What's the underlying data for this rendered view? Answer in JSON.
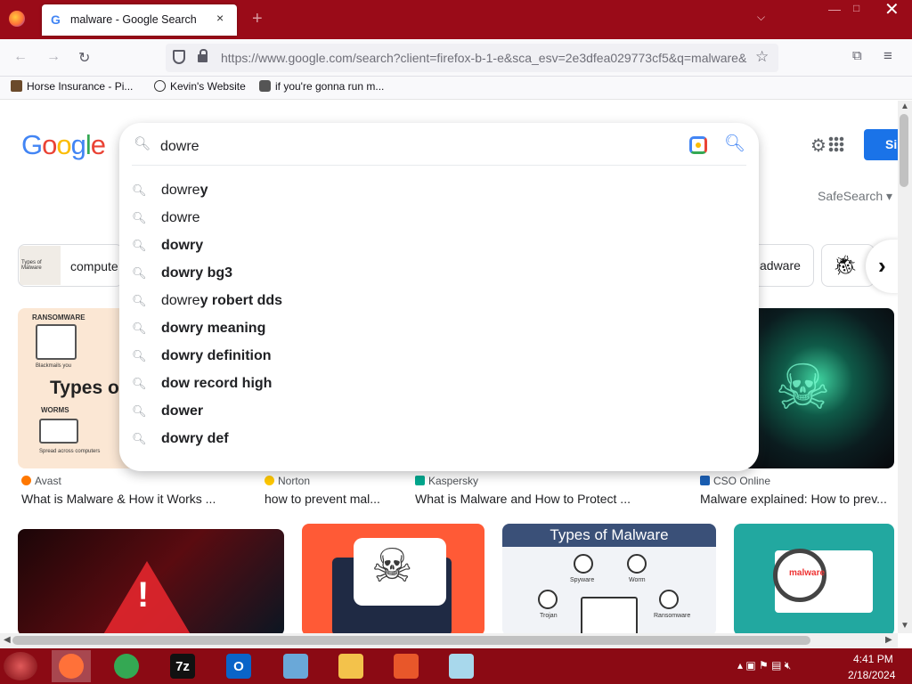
{
  "browser": {
    "tab": {
      "favicon": "G",
      "title": "malware - Google Search",
      "close_icon": "×"
    },
    "new_tab_icon": "+",
    "url": "https://www.google.com/search?client=firefox-b-1-e&sca_esv=2e3dfea029773cf5&q=malware&",
    "bookmarks": [
      {
        "label": "Horse Insurance - Pi..."
      },
      {
        "label": "Kevin's Website"
      },
      {
        "label": "if you're gonna run m..."
      }
    ]
  },
  "google": {
    "logo": [
      "G",
      "o",
      "o",
      "g",
      "l",
      "e"
    ],
    "logo_colors": [
      "#4285f4",
      "#ea4335",
      "#fbbc05",
      "#4285f4",
      "#34a853",
      "#ea4335"
    ],
    "safesearch": "SafeSearch",
    "signin_label": "Si",
    "search_value": "dowre",
    "suggestions": [
      {
        "prefix": "dowre",
        "bold": "y"
      },
      {
        "prefix": "dowre",
        "bold": ""
      },
      {
        "prefix": "",
        "bold": "dowry"
      },
      {
        "prefix": "",
        "bold": "dowry bg3"
      },
      {
        "prefix": "dowre",
        "bold": "y robert dds"
      },
      {
        "prefix": "",
        "bold": "dowry meaning"
      },
      {
        "prefix": "",
        "bold": "dowry definition"
      },
      {
        "prefix": "",
        "bold": "dow record high"
      },
      {
        "prefix": "",
        "bold": "dower"
      },
      {
        "prefix": "",
        "bold": "dowry def"
      }
    ],
    "filters": {
      "left_label": "compute",
      "left_thumb_text": "Types of Malware",
      "adware_label": "adware"
    },
    "images": {
      "img1": {
        "title": "Types o",
        "s1": "RANSOMWARE",
        "s2": "WORMS",
        "cap1": "Blackmails you",
        "cap2": "Spread across computers"
      },
      "img7": {
        "header": "Types of Malware",
        "spyware": "Spyware",
        "worm": "Worm",
        "trojan": "Trojan",
        "ransomware": "Ransomware"
      },
      "img8": {
        "label": "malware"
      }
    },
    "results": [
      {
        "source": "Avast",
        "title": "What is Malware & How it Works ...",
        "color": "#ff7800"
      },
      {
        "source": "Norton",
        "title": "how to prevent mal...",
        "color": "#ffc800"
      },
      {
        "source": "Kaspersky",
        "title": "What is Malware and How to Protect ...",
        "color": "#00a88e"
      },
      {
        "source": "CSO Online",
        "title": "Malware explained: How to prev...",
        "color": "#1a5fb4"
      }
    ]
  },
  "taskbar": {
    "apps": [
      {
        "name": "firefox",
        "color": "#ff7139"
      },
      {
        "name": "chrome",
        "color": "#34a853"
      },
      {
        "name": "7zip",
        "label": "7z",
        "color": "#111111"
      },
      {
        "name": "outlook",
        "label": "O",
        "color": "#0a64c8"
      },
      {
        "name": "control-panel",
        "color": "#6aa8d8"
      },
      {
        "name": "file-explorer",
        "color": "#f3c24b"
      },
      {
        "name": "media-player",
        "color": "#e8572a"
      },
      {
        "name": "notepad",
        "color": "#a8d8ec"
      }
    ],
    "time": "4:41 PM",
    "date": "2/18/2024"
  }
}
